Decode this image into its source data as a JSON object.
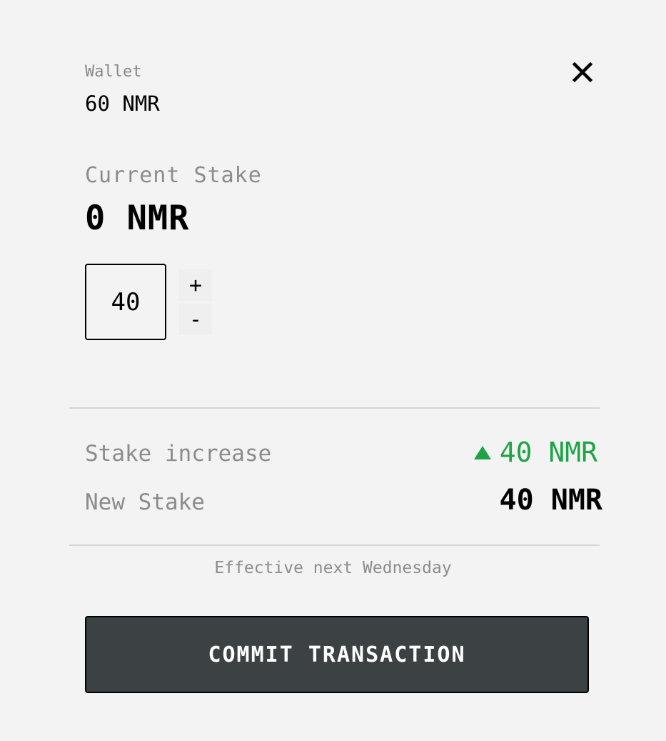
{
  "wallet": {
    "label": "Wallet",
    "value": "60 NMR"
  },
  "close": {
    "icon": "close-icon"
  },
  "current_stake": {
    "label": "Current Stake",
    "value": "0 NMR"
  },
  "stake_input": {
    "value": "40"
  },
  "stepper": {
    "plus_label": "+",
    "minus_label": "-"
  },
  "summary": {
    "increase_label": "Stake increase",
    "increase_value": "40 NMR",
    "increase_icon": "triangle-up-icon",
    "increase_color": "#1ea446",
    "new_label": "New Stake",
    "new_value": "40 NMR"
  },
  "note": "Effective next Wednesday",
  "commit": {
    "label": "COMMIT TRANSACTION",
    "background": "#3c4244"
  }
}
